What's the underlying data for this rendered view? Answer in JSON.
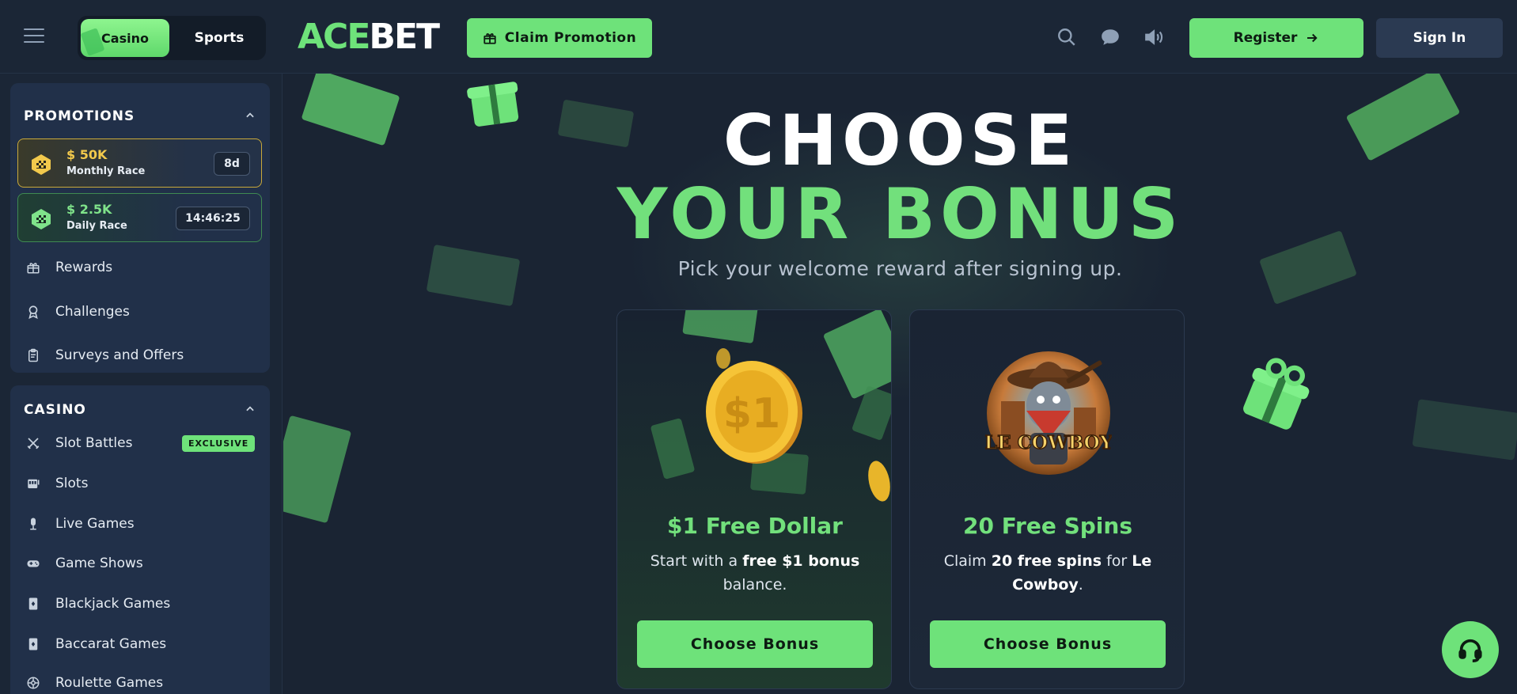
{
  "header": {
    "mode_tabs": {
      "casino": "Casino",
      "sports": "Sports"
    },
    "logo": {
      "part1": "ACE",
      "part2": "BET"
    },
    "claim_label": "Claim Promotion",
    "register_label": "Register",
    "signin_label": "Sign In",
    "icons": [
      "menu-icon",
      "search-icon",
      "chat-icon",
      "sound-icon",
      "gift-icon",
      "arrow-right-icon"
    ]
  },
  "sidebar": {
    "promotions": {
      "title": "PROMOTIONS",
      "races": [
        {
          "amount": "$ 50K",
          "name": "Monthly Race",
          "badge": "8d"
        },
        {
          "amount": "$ 2.5K",
          "name": "Daily Race",
          "badge": "14:46:25"
        }
      ],
      "items": [
        {
          "label": "Rewards",
          "icon": "gift-icon"
        },
        {
          "label": "Challenges",
          "icon": "medal-icon"
        },
        {
          "label": "Surveys and Offers",
          "icon": "clipboard-icon"
        }
      ]
    },
    "casino": {
      "title": "CASINO",
      "items": [
        {
          "label": "Slot Battles",
          "icon": "swords-icon",
          "badge": "EXCLUSIVE"
        },
        {
          "label": "Slots",
          "icon": "slot-machine-icon"
        },
        {
          "label": "Live Games",
          "icon": "microphone-icon"
        },
        {
          "label": "Game Shows",
          "icon": "gamepad-icon"
        },
        {
          "label": "Blackjack Games",
          "icon": "card-icon"
        },
        {
          "label": "Baccarat Games",
          "icon": "card-icon"
        },
        {
          "label": "Roulette Games",
          "icon": "roulette-icon"
        }
      ]
    }
  },
  "main": {
    "heading_line1": "CHOOSE",
    "heading_line2": "YOUR BONUS",
    "subtitle": "Pick your welcome reward after signing up.",
    "cards": [
      {
        "title": "$1 Free Dollar",
        "desc_pre": "Start with a ",
        "desc_bold": "free $1 bonus",
        "desc_post": " balance.",
        "coin_text": "$1",
        "button": "Choose Bonus"
      },
      {
        "title": "20 Free Spins",
        "desc_pre": "Claim ",
        "desc_bold": "20 free spins",
        "desc_mid": " for ",
        "desc_bold2": "Le Cowboy",
        "desc_post": ".",
        "game_logo": "LE COWBOY",
        "button": "Choose Bonus"
      }
    ]
  },
  "colors": {
    "accent_green": "#6ee27a",
    "background": "#1a2433",
    "gold": "#f2c94c"
  }
}
